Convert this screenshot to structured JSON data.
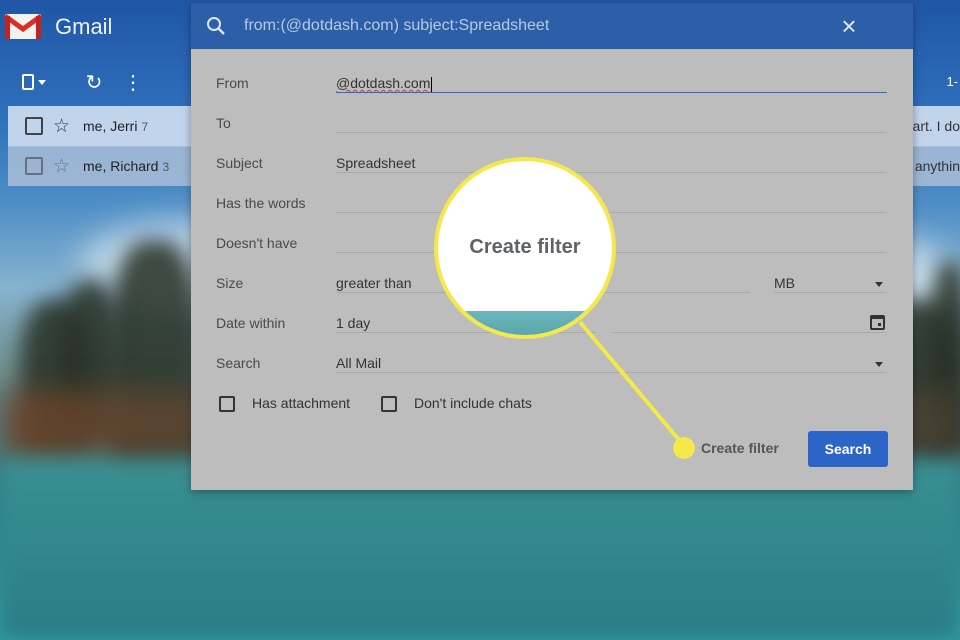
{
  "app": {
    "name": "Gmail"
  },
  "toolbar": {
    "count_text": "1-"
  },
  "mail_rows": [
    {
      "sender": "me, Jerri",
      "count": "7",
      "snippet": "art. I do"
    },
    {
      "sender": "me, Richard",
      "count": "3",
      "snippet": "anythin"
    }
  ],
  "dialog": {
    "query": "from:(@dotdash.com) subject:Spreadsheet",
    "fields": {
      "from_label": "From",
      "from_value": "@dotdash.com",
      "to_label": "To",
      "subject_label": "Subject",
      "subject_value": "Spreadsheet",
      "has_words_label": "Has the words",
      "doesnt_have_label": "Doesn't have",
      "size_label": "Size",
      "size_operator": "greater than",
      "size_unit": "MB",
      "date_within_label": "Date within",
      "date_within_value": "1 day",
      "search_label": "Search",
      "search_value": "All Mail"
    },
    "checkboxes": {
      "has_attachment": "Has attachment",
      "dont_include_chats": "Don't include chats"
    },
    "buttons": {
      "create_filter": "Create filter",
      "search": "Search"
    }
  },
  "callout": {
    "text": "Create filter"
  },
  "colors": {
    "header_blue": "#2d5fa8",
    "search_button": "#2d64c8",
    "callout_yellow": "#f4e84b"
  }
}
